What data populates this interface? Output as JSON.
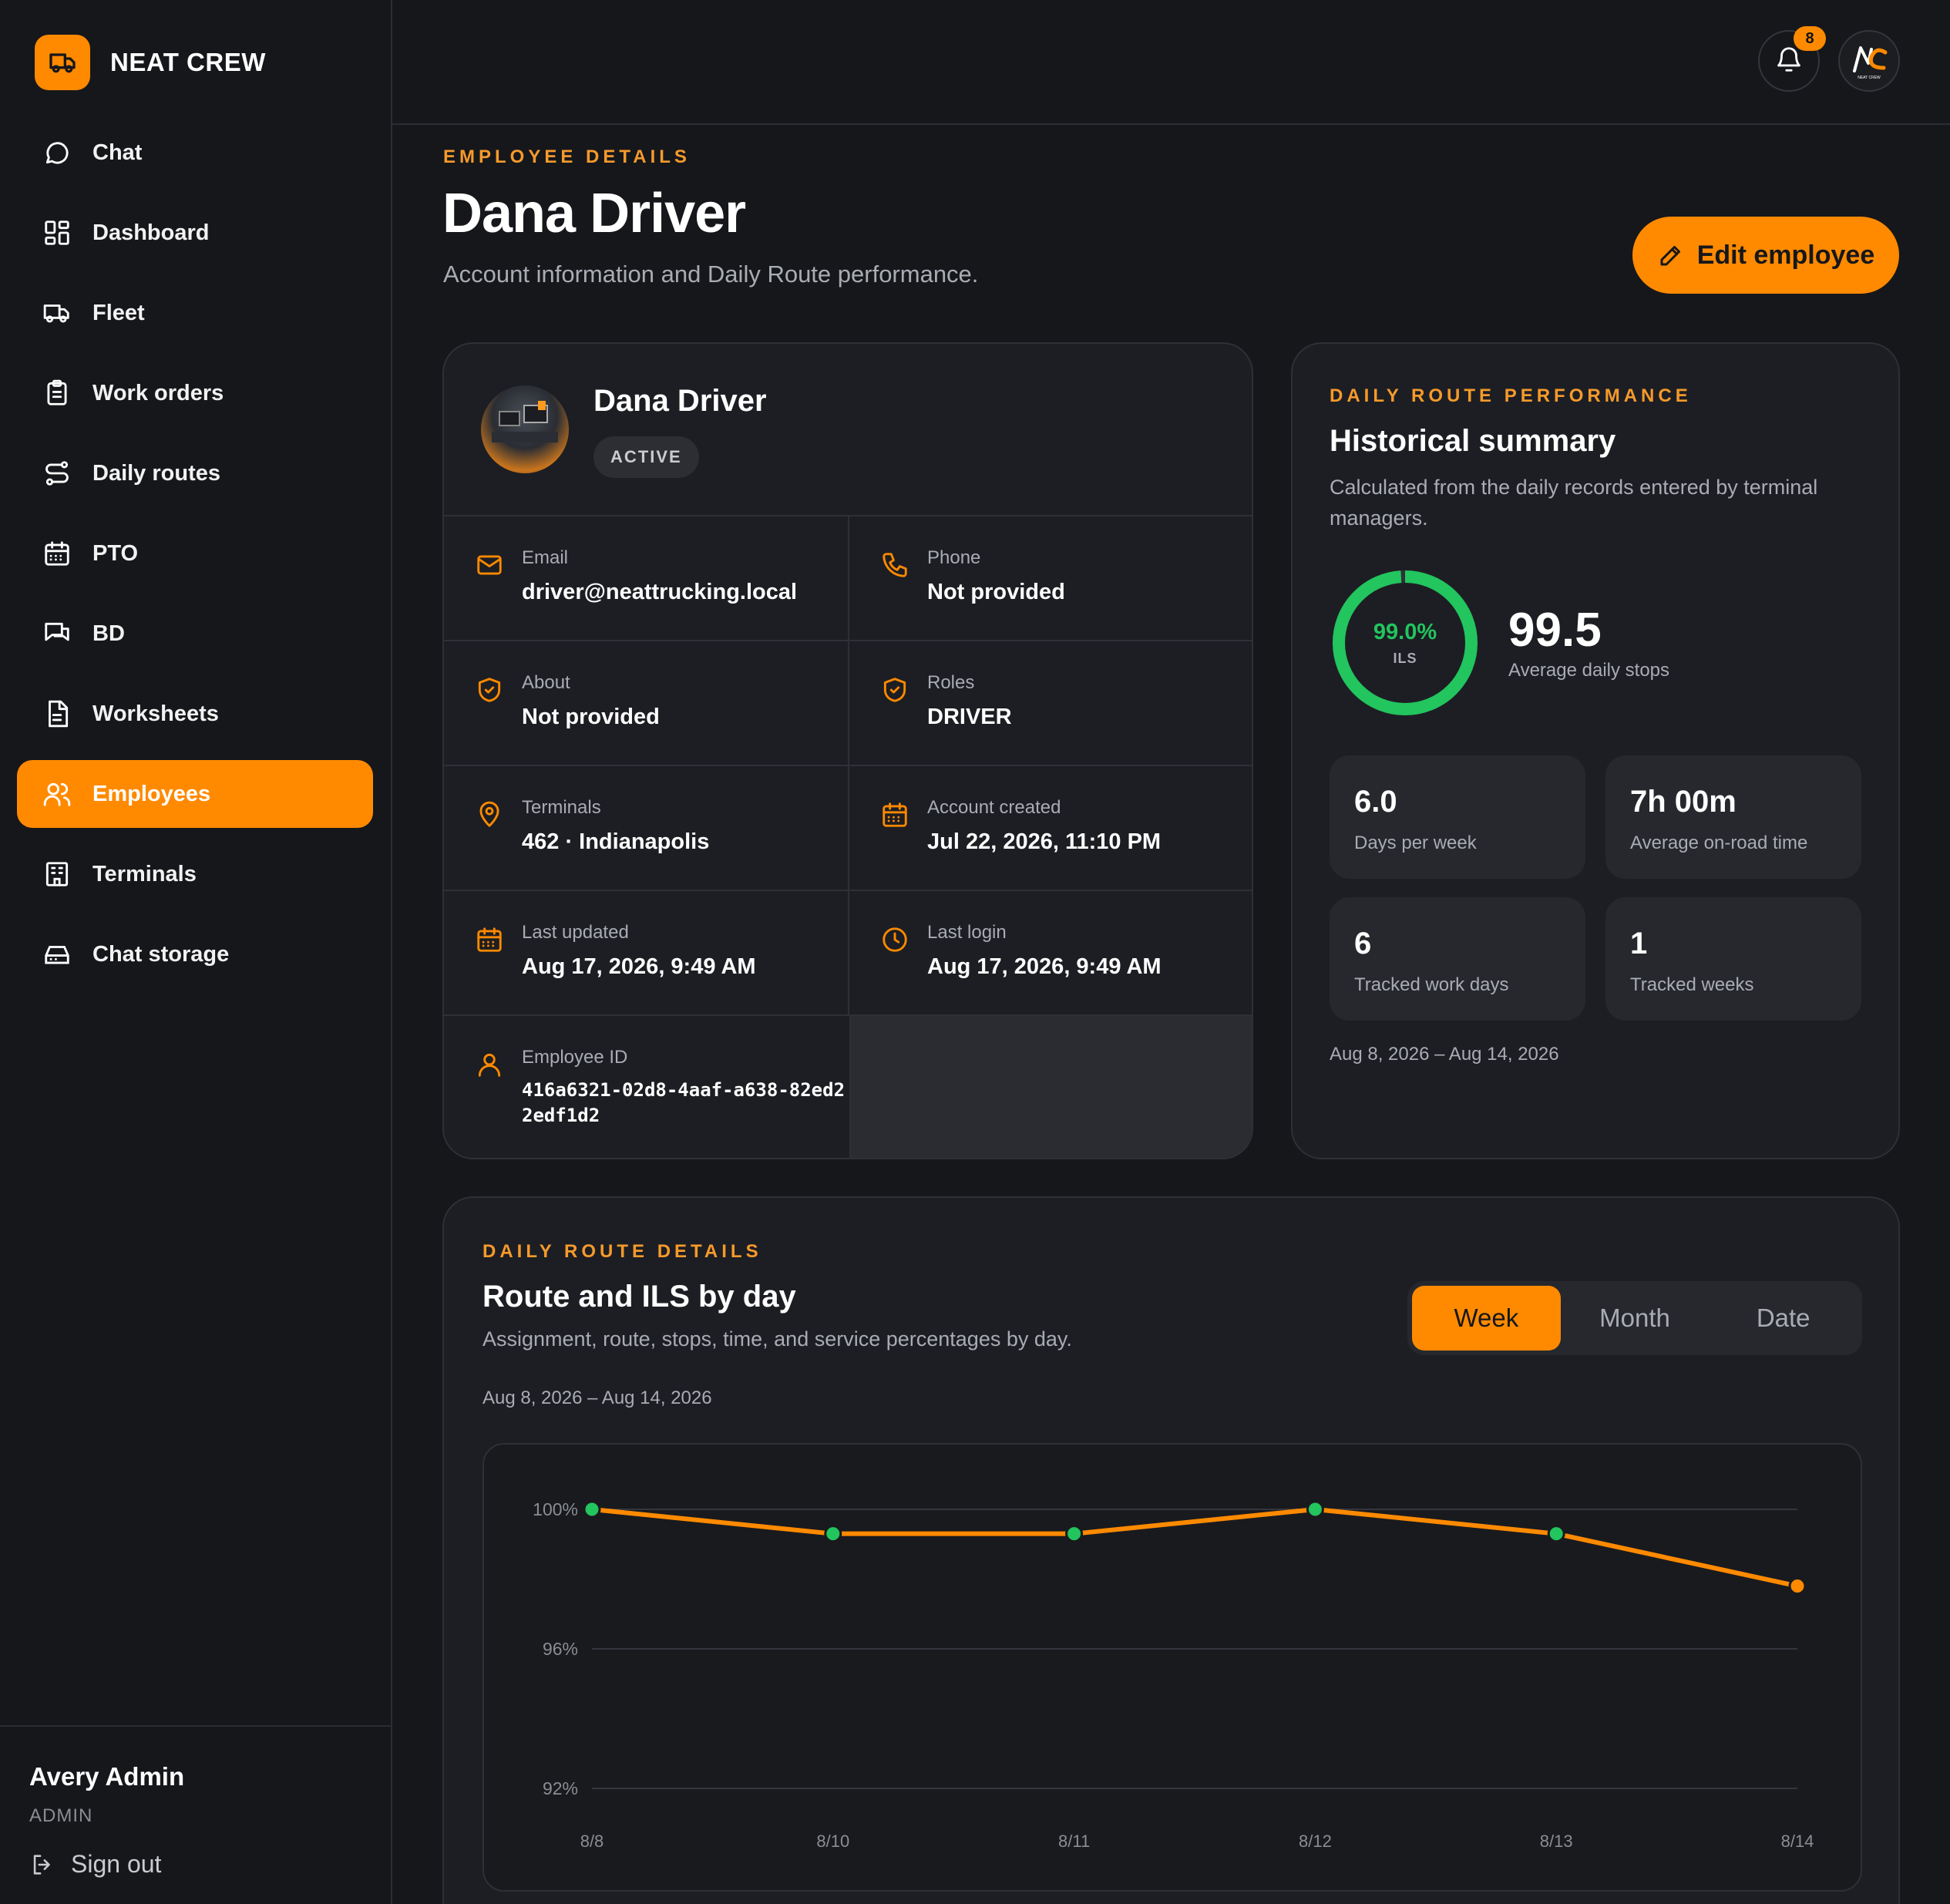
{
  "brand": {
    "name": "NEAT CREW",
    "icon": "truck-icon"
  },
  "nav": {
    "items": [
      {
        "label": "Chat",
        "icon": "chat-icon"
      },
      {
        "label": "Dashboard",
        "icon": "dashboard-icon"
      },
      {
        "label": "Fleet",
        "icon": "truck-icon"
      },
      {
        "label": "Work orders",
        "icon": "clipboard-icon"
      },
      {
        "label": "Daily routes",
        "icon": "route-icon"
      },
      {
        "label": "PTO",
        "icon": "calendar-icon"
      },
      {
        "label": "BD",
        "icon": "messages-icon"
      },
      {
        "label": "Worksheets",
        "icon": "document-icon"
      },
      {
        "label": "Employees",
        "icon": "users-icon",
        "active": true
      },
      {
        "label": "Terminals",
        "icon": "building-icon"
      },
      {
        "label": "Chat storage",
        "icon": "storage-icon"
      }
    ]
  },
  "user": {
    "name": "Avery Admin",
    "role": "ADMIN",
    "signout_label": "Sign out"
  },
  "topbar": {
    "notification_count": "8",
    "avatar_logo": "NEAT CREW"
  },
  "header": {
    "eyebrow": "EMPLOYEE DETAILS",
    "title": "Dana Driver",
    "subtitle": "Account information and Daily Route performance.",
    "edit_label": "Edit employee"
  },
  "profile": {
    "name": "Dana Driver",
    "status": "ACTIVE",
    "fields": {
      "email": {
        "label": "Email",
        "value": "driver@neattrucking.local"
      },
      "phone": {
        "label": "Phone",
        "value": "Not provided"
      },
      "about": {
        "label": "About",
        "value": "Not provided"
      },
      "roles": {
        "label": "Roles",
        "value": "DRIVER"
      },
      "terminals": {
        "label": "Terminals",
        "value": "462 · Indianapolis"
      },
      "created": {
        "label": "Account created",
        "value": "Jul 22, 2026, 11:10 PM"
      },
      "updated": {
        "label": "Last updated",
        "value": "Aug 17, 2026, 9:49 AM"
      },
      "login": {
        "label": "Last login",
        "value": "Aug 17, 2026, 9:49 AM"
      },
      "employee_id": {
        "label": "Employee ID",
        "value": "416a6321-02d8-4aaf-a638-82ed22edf1d2"
      }
    }
  },
  "performance": {
    "eyebrow": "DAILY ROUTE PERFORMANCE",
    "title": "Historical summary",
    "subtitle": "Calculated from the daily records entered by terminal managers.",
    "ils_pct": "99.0%",
    "ils_value": 0.99,
    "ils_label": "ILS",
    "avg_stops": "99.5",
    "avg_stops_label": "Average daily stops",
    "tiles": [
      {
        "value": "6.0",
        "label": "Days per week"
      },
      {
        "value": "7h 00m",
        "label": "Average on-road time"
      },
      {
        "value": "6",
        "label": "Tracked work days"
      },
      {
        "value": "1",
        "label": "Tracked weeks"
      }
    ],
    "range": "Aug 8, 2026 – Aug 14, 2026"
  },
  "route": {
    "eyebrow": "DAILY ROUTE DETAILS",
    "title": "Route and ILS by day",
    "subtitle": "Assignment, route, stops, time, and service percentages by day.",
    "range": "Aug 8, 2026 – Aug 14, 2026",
    "tabs": [
      "Week",
      "Month",
      "Date"
    ],
    "active_tab": "Week"
  },
  "chart_data": {
    "type": "line",
    "categories": [
      "8/8",
      "8/10",
      "8/11",
      "8/12",
      "8/13",
      "8/14"
    ],
    "series": [
      {
        "values": [
          100,
          99.3,
          99.3,
          100,
          99.3,
          97.8
        ],
        "marker_colors": [
          "#22c55e",
          "#22c55e",
          "#22c55e",
          "#22c55e",
          "#22c55e",
          "#ff8a00"
        ]
      }
    ],
    "yticks": [
      "100%",
      "96%",
      "92%"
    ],
    "ytick_values": [
      100,
      96,
      92
    ],
    "ylim": [
      92,
      100
    ],
    "grid": true,
    "line_color": "#ff8a00"
  }
}
